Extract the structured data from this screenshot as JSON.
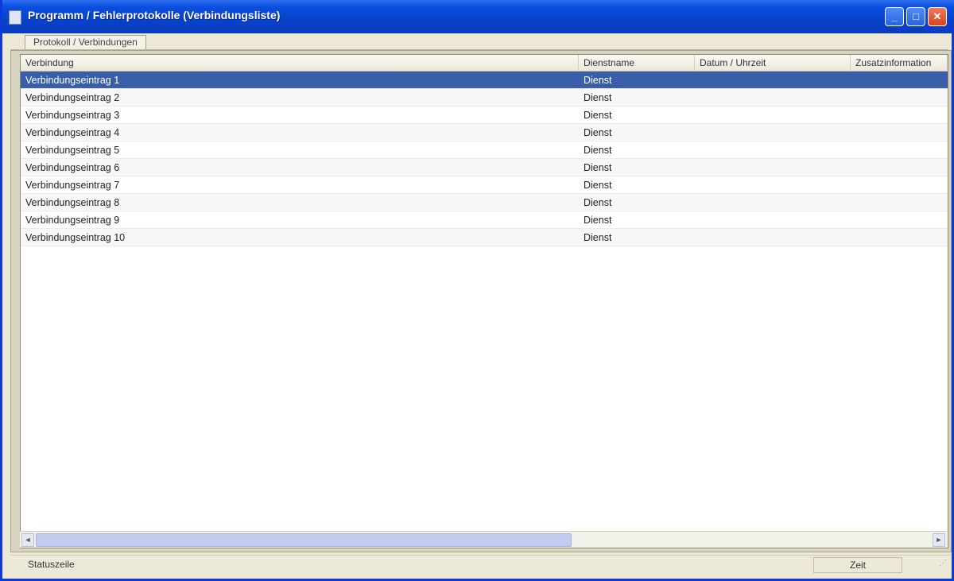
{
  "window": {
    "title": "Programm / Fehlerprotokolle  (Verbindungsliste)",
    "buttons": {
      "minimize": "_",
      "maximize": "□",
      "close": "✕"
    }
  },
  "tabs": [
    {
      "label": "Protokoll / Verbindungen"
    }
  ],
  "table": {
    "columns": [
      "Verbindung",
      "Dienstname",
      "Datum / Uhrzeit",
      "Zusatzinformation"
    ],
    "rows": [
      {
        "name": "Verbindungseintrag 1",
        "service": "Dienst",
        "date": "",
        "info": "",
        "selected": true
      },
      {
        "name": "Verbindungseintrag 2",
        "service": "Dienst",
        "date": "",
        "info": ""
      },
      {
        "name": "Verbindungseintrag 3",
        "service": "Dienst",
        "date": "",
        "info": ""
      },
      {
        "name": "Verbindungseintrag 4",
        "service": "Dienst",
        "date": "",
        "info": ""
      },
      {
        "name": "Verbindungseintrag 5",
        "service": "Dienst",
        "date": "",
        "info": ""
      },
      {
        "name": "Verbindungseintrag 6",
        "service": "Dienst",
        "date": "",
        "info": ""
      },
      {
        "name": "Verbindungseintrag 7",
        "service": "Dienst",
        "date": "",
        "info": ""
      },
      {
        "name": "Verbindungseintrag 8",
        "service": "Dienst",
        "date": "",
        "info": ""
      },
      {
        "name": "Verbindungseintrag 9",
        "service": "Dienst",
        "date": "",
        "info": ""
      },
      {
        "name": "Verbindungseintrag 10",
        "service": "Dienst",
        "date": "",
        "info": ""
      }
    ]
  },
  "status": {
    "left": "Statuszeile",
    "right": "Zeit"
  },
  "scroll": {
    "left_arrow": "◄",
    "right_arrow": "►"
  },
  "colors": {
    "titlebar": "#0a4fe0",
    "selection": "#3b5ea8"
  }
}
